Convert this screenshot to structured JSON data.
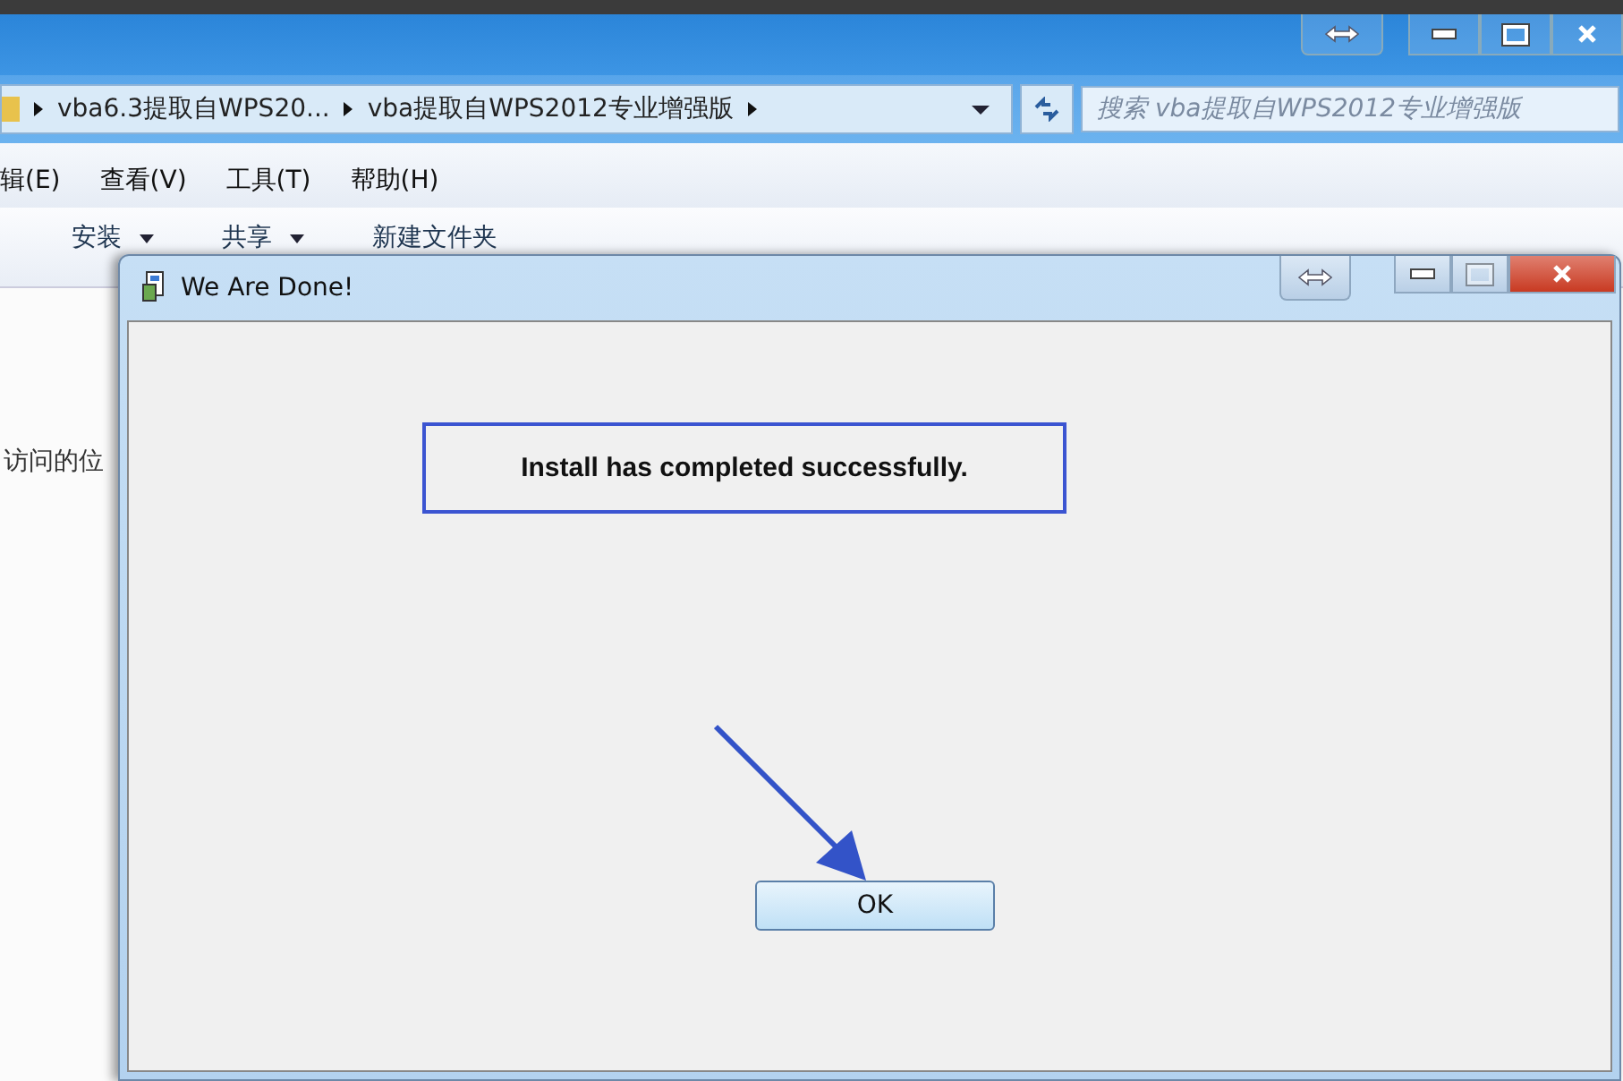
{
  "explorer": {
    "breadcrumbs": [
      "vba6.3提取自WPS20...",
      "vba提取自WPS2012专业增强版"
    ],
    "search": {
      "placeholder": "搜索 vba提取自WPS2012专业增强版"
    },
    "menu": [
      "辑(E)",
      "查看(V)",
      "工具(T)",
      "帮助(H)"
    ],
    "toolbar": [
      {
        "label": "安装",
        "kind": "menu"
      },
      {
        "label": "共享",
        "kind": "menu"
      },
      {
        "label": "新建文件夹",
        "kind": "plain"
      }
    ],
    "nav_text": "访问的位"
  },
  "dialog": {
    "title": "We Are Done!",
    "message": "Install has completed successfully.",
    "button": "OK"
  }
}
